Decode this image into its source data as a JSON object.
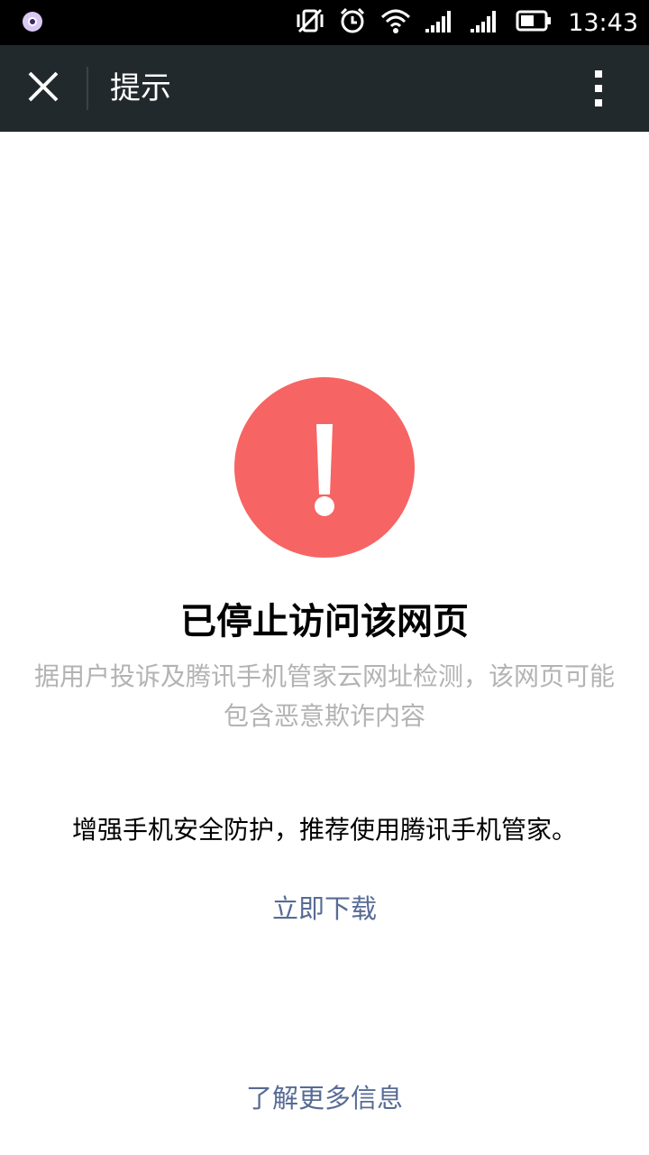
{
  "status_bar": {
    "time": "13:43",
    "icons": [
      "app-notification-icon",
      "vibrate-off-icon",
      "alarm-icon",
      "wifi-icon",
      "signal-icon",
      "signal-icon",
      "battery-icon"
    ]
  },
  "title_bar": {
    "title": "提示",
    "close_icon": "close-icon",
    "more_icon": "more-vertical-icon"
  },
  "content": {
    "warning_icon": "exclamation-circle-icon",
    "warning_color": "#f76464",
    "title": "已停止访问该网页",
    "description": "据用户投诉及腾讯手机管家云网址检测，该网页可能包含恶意欺诈内容",
    "recommendation": "增强手机安全防护，推荐使用腾讯手机管家。",
    "download_link": "立即下载",
    "learn_more_link": "了解更多信息",
    "link_color": "#576b95"
  }
}
